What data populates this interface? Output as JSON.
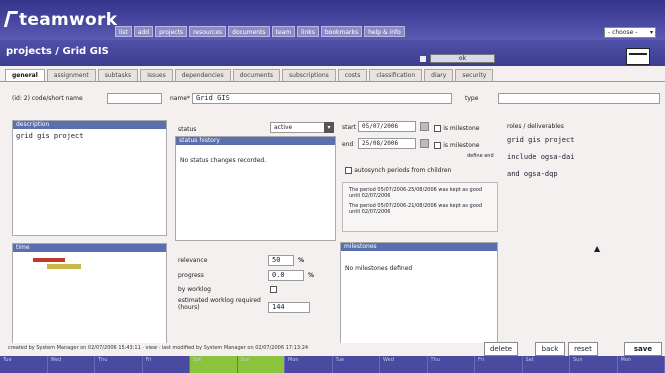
{
  "app": {
    "name": "teamwork"
  },
  "main_nav": [
    "list",
    "add",
    "projects",
    "resources",
    "documents",
    "team",
    "links",
    "bookmarks",
    "help & info"
  ],
  "chooser": {
    "label": "- choose -"
  },
  "page": {
    "title": "projects / Grid GIS",
    "status_button": "ok"
  },
  "tabs": [
    "general",
    "assignment",
    "subtasks",
    "issues",
    "dependencies",
    "documents",
    "subscriptions",
    "costs",
    "classification",
    "diary",
    "security"
  ],
  "active_tab": "general",
  "form": {
    "id_label": "(id: 2) code/short name",
    "id_value": "",
    "name_label": "name*",
    "name_value": "Grid GIS",
    "type_label": "type",
    "type_value": ""
  },
  "description": {
    "header": "description",
    "text": "grid gis project"
  },
  "timeline": {
    "header": "time"
  },
  "status": {
    "label": "status",
    "value": "active"
  },
  "dates": {
    "start_label": "start",
    "start_value": "05/07/2006",
    "start_milestone": "is milestone",
    "end_label": "end",
    "end_value": "25/08/2006",
    "end_milestone": "is milestone",
    "define_end": "define end",
    "autosynch": "autosynch periods from children"
  },
  "period_notes": [
    "The period 05/07/2006-25/08/2006 was kept as good until 02/07/2006",
    "The period 05/07/2006-21/08/2006 was kept as good until 02/07/2006"
  ],
  "status_history": {
    "header": "status history",
    "text": "No status changes recorded."
  },
  "metrics": {
    "relevance_label": "relevance",
    "relevance_value": "50",
    "relevance_unit": "%",
    "progress_label": "progress",
    "progress_value": "0.0",
    "progress_unit": "%",
    "by_worklog_label": "by worklog",
    "estimated_label": "estimated worklog required (hours)",
    "estimated_value": "144"
  },
  "milestones": {
    "header": "milestones",
    "text": "No milestones defined"
  },
  "roles": {
    "header": "roles / deliverables",
    "items": [
      "grid gis project",
      "include ogsa-dai",
      "and ogsa-dqp"
    ]
  },
  "footer": {
    "info": "created by System Manager on 02/07/2006 15:43:11 · view · last modified by System Manager on 02/07/2006 17:13:24",
    "delete_button": "delete",
    "back_button": "back",
    "reset_button": "reset",
    "save_button": "save"
  },
  "bottom_bar": [
    "Tue",
    "Wed",
    "Thu",
    "Fri",
    "Sat",
    "Sun",
    "Mon",
    "Tue",
    "Wed",
    "Thu",
    "Fri",
    "Sat",
    "Sun",
    "Mon"
  ],
  "colors": {
    "header": "#3c3c90",
    "panel_head": "#5a6fb0",
    "timeline_bar_1": "#c0392b",
    "timeline_bar_2": "#c8b84a",
    "bottom_highlight": "#8ac43c"
  }
}
